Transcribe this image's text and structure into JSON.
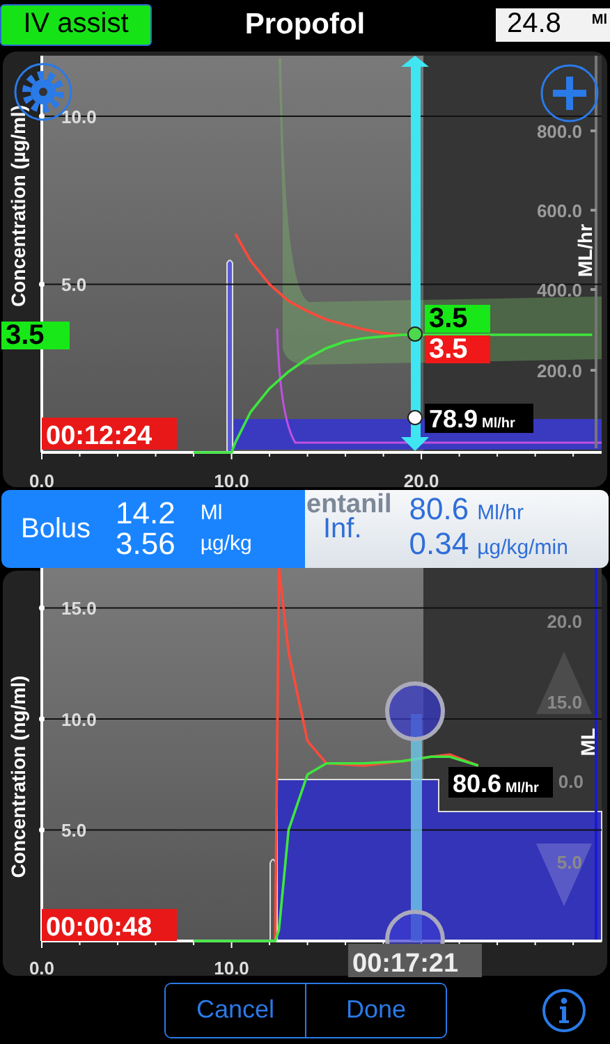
{
  "header": {
    "mode_button": "IV assist",
    "title": "Propofol",
    "volume": {
      "value": "24.8",
      "unit": "Ml"
    }
  },
  "top_chart": {
    "elapsed": "00:12:24",
    "target_badge": "3.5",
    "effect_badge": "3.5",
    "plasma_badge": "3.5",
    "rate_badge": {
      "value": "78.9",
      "unit": "Ml/hr"
    },
    "rate_axis": {
      "label": "ML/hr",
      "ticks": [
        "800.0",
        "600.0",
        "400.0",
        "200.0"
      ]
    },
    "chart_data": {
      "type": "line",
      "ylabel": "Concentration (µg/ml)",
      "grid": true,
      "x": [
        8,
        10,
        10.2,
        11,
        12,
        13,
        14,
        15,
        16,
        17,
        18,
        19,
        20,
        22,
        24,
        26,
        29
      ],
      "series": [
        {
          "color": "#ff4a3a",
          "values": [
            null,
            null,
            6.5,
            5.7,
            5.0,
            4.5,
            4.2,
            3.95,
            3.8,
            3.65,
            3.55,
            3.5,
            null,
            null,
            null,
            null,
            null
          ]
        },
        {
          "color": "#3ee63e",
          "values": [
            0,
            0,
            0.3,
            1.2,
            1.9,
            2.4,
            2.8,
            3.1,
            3.3,
            3.4,
            3.45,
            3.5,
            3.5,
            3.5,
            3.5,
            3.5,
            3.5
          ]
        }
      ],
      "xlim": [
        0,
        29.5
      ],
      "ylim": [
        0,
        11.8
      ],
      "xticks": [
        {
          "value": 0,
          "label": "0.0"
        },
        {
          "value": 10,
          "label": "10.0"
        },
        {
          "value": 20,
          "label": "20.0"
        }
      ],
      "yticks": [
        {
          "value": 5,
          "label": "5.0"
        },
        {
          "value": 10,
          "label": "10.0"
        }
      ]
    }
  },
  "dose_bar": {
    "bolus": {
      "label": "Bolus",
      "volume": "14.2",
      "volume_unit": "Ml",
      "dose": "3.56",
      "dose_unit": "µg/kg"
    },
    "next_drug": "entanil",
    "infusion": {
      "label": "Inf.",
      "rate": "80.6",
      "rate_unit": "Ml/hr",
      "dose": "0.34",
      "dose_unit": "µg/kg/min"
    }
  },
  "bottom_chart": {
    "elapsed": "00:00:48",
    "cursor_time": "00:17:21",
    "rate_badge": {
      "value": "80.6",
      "unit": "Ml/hr"
    },
    "volume_axis": {
      "label": "ML",
      "ticks": [
        "20.0",
        "15.0",
        "0.0",
        "5.0"
      ]
    },
    "chart_data": {
      "type": "line",
      "ylabel": "Concentration (ng/ml)",
      "grid": true,
      "x": [
        8,
        12.3,
        12.5,
        13,
        14,
        15,
        17,
        19,
        20.5,
        21.5,
        23
      ],
      "series": [
        {
          "color": "#ff4a3a",
          "values": [
            null,
            0,
            16.8,
            13,
            9,
            8,
            7.9,
            8.1,
            8.3,
            8.4,
            7.9
          ]
        },
        {
          "color": "#3ee63e",
          "values": [
            0,
            0,
            0.5,
            5,
            7.5,
            8,
            8,
            8.1,
            8.3,
            8.3,
            7.9
          ]
        }
      ],
      "xlim": [
        0,
        29.5
      ],
      "ylim": [
        0,
        16.8
      ],
      "xticks": [
        {
          "value": 0,
          "label": "0.0"
        },
        {
          "value": 10,
          "label": "10.0"
        }
      ],
      "yticks": [
        {
          "value": 5,
          "label": "5.0"
        },
        {
          "value": 10,
          "label": "10.0"
        },
        {
          "value": 15,
          "label": "15.0"
        }
      ]
    }
  },
  "buttons": [
    "Cancel",
    "Done"
  ]
}
